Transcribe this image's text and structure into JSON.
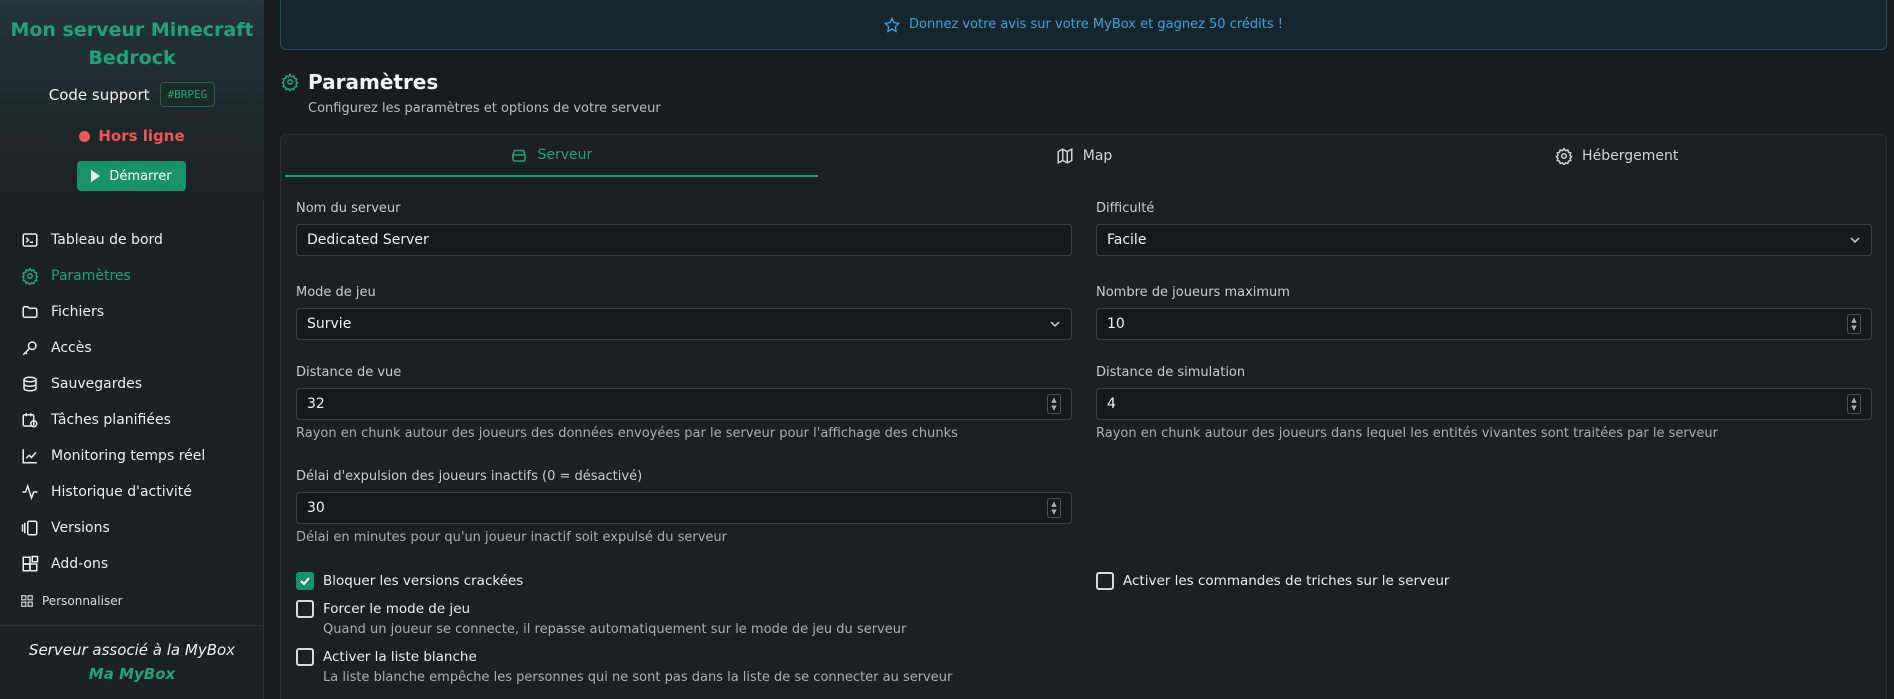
{
  "sidebar": {
    "server_name": "Mon serveur Minecraft Bedrock",
    "support_label": "Code support",
    "support_code": "#BRPEG",
    "status": "Hors ligne",
    "start_label": "Démarrer",
    "items": [
      {
        "label": "Tableau de bord",
        "icon": "terminal-icon"
      },
      {
        "label": "Paramètres",
        "icon": "gear-icon",
        "active": true
      },
      {
        "label": "Fichiers",
        "icon": "folder-icon"
      },
      {
        "label": "Accès",
        "icon": "key-icon"
      },
      {
        "label": "Sauvegardes",
        "icon": "database-icon"
      },
      {
        "label": "Tâches planifiées",
        "icon": "calendar-clock-icon"
      },
      {
        "label": "Monitoring temps réel",
        "icon": "line-chart-icon"
      },
      {
        "label": "Historique d'activité",
        "icon": "activity-icon"
      },
      {
        "label": "Versions",
        "icon": "versions-icon"
      },
      {
        "label": "Add-ons",
        "icon": "blocks-icon"
      }
    ],
    "customize_label": "Personnaliser",
    "associated_text": "Serveur associé à la MyBox",
    "associated_link": "Ma MyBox"
  },
  "banner": {
    "text": "Donnez votre avis sur votre MyBox et gagnez 50 crédits !"
  },
  "page": {
    "title": "Paramètres",
    "subtitle": "Configurez les paramètres et options de votre serveur"
  },
  "tabs": [
    {
      "label": "Serveur",
      "active": true
    },
    {
      "label": "Map"
    },
    {
      "label": "Hébergement"
    }
  ],
  "form": {
    "server_name_label": "Nom du serveur",
    "server_name_value": "Dedicated Server",
    "difficulty_label": "Difficulté",
    "difficulty_value": "Facile",
    "gamemode_label": "Mode de jeu",
    "gamemode_value": "Survie",
    "max_players_label": "Nombre de joueurs maximum",
    "max_players_value": "10",
    "view_distance_label": "Distance de vue",
    "view_distance_value": "32",
    "view_distance_help": "Rayon en chunk autour des joueurs des données envoyées par le serveur pour l'affichage des chunks",
    "sim_distance_label": "Distance de simulation",
    "sim_distance_value": "4",
    "sim_distance_help": "Rayon en chunk autour des joueurs dans lequel les entités vivantes sont traitées par le serveur",
    "idle_kick_label": "Délai d'expulsion des joueurs inactifs (0 = désactivé)",
    "idle_kick_value": "30",
    "idle_kick_help": "Délai en minutes pour qu'un joueur inactif soit expulsé du serveur",
    "block_cracked_label": "Bloquer les versions crackées",
    "block_cracked_checked": true,
    "cheats_label": "Activer les commandes de triches sur le serveur",
    "cheats_checked": false,
    "force_gamemode_label": "Forcer le mode de jeu",
    "force_gamemode_help": "Quand un joueur se connecte, il repasse automatiquement sur le mode de jeu du serveur",
    "force_gamemode_checked": false,
    "whitelist_label": "Activer la liste blanche",
    "whitelist_help": "La liste blanche empêche les personnes qui ne sont pas dans la liste de se connecter au serveur",
    "whitelist_checked": false
  },
  "colors": {
    "accent": "#1fa37a",
    "danger": "#f25757",
    "info": "#3aa3e3"
  }
}
